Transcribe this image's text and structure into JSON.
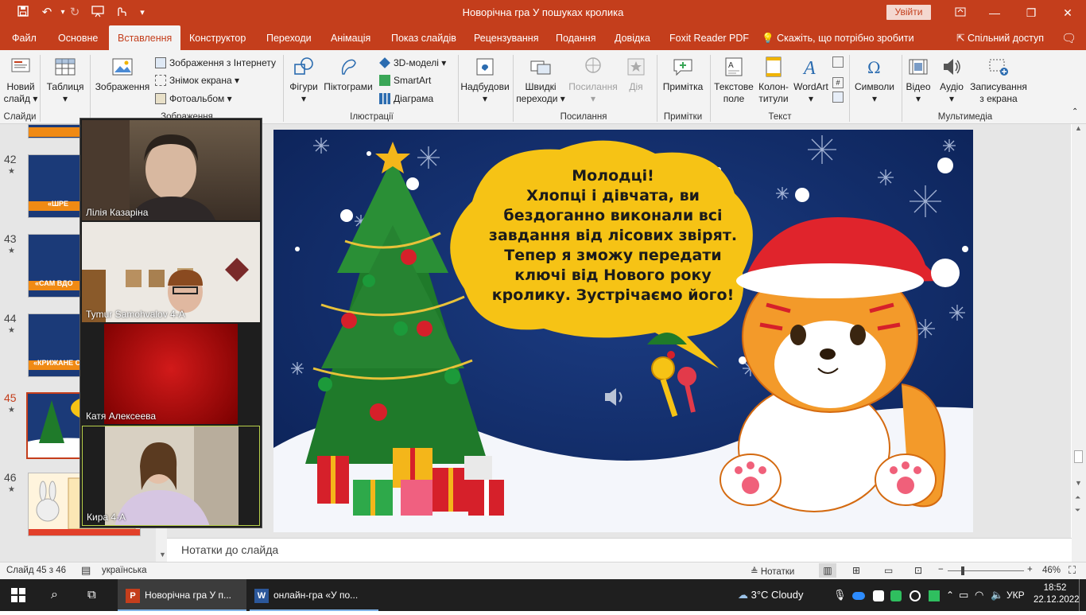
{
  "window": {
    "title": "Новорічна гра У пошуках кролика",
    "signin_label": "Увійти"
  },
  "tabs": [
    {
      "label": "Файл"
    },
    {
      "label": "Основне"
    },
    {
      "label": "Вставлення"
    },
    {
      "label": "Конструктор"
    },
    {
      "label": "Переходи"
    },
    {
      "label": "Анімація"
    },
    {
      "label": "Показ слайдів"
    },
    {
      "label": "Рецензування"
    },
    {
      "label": "Подання"
    },
    {
      "label": "Довідка"
    },
    {
      "label": "Foxit Reader PDF"
    }
  ],
  "tellme": "Скажіть, що потрібно зробити",
  "share": "Спільний доступ",
  "ribbon": {
    "new_slide": [
      "Новий",
      "слайд"
    ],
    "table": "Таблиця",
    "images": "Зображення",
    "online_images": "Зображення з Інтернету",
    "screenshot": "Знімок екрана",
    "photo_album": "Фотоальбом",
    "shapes": "Фігури",
    "icons": "Піктограми",
    "models3d": "3D-моделі",
    "smartart": "SmartArt",
    "chart": "Діаграма",
    "addins": "Надбудови",
    "zoom": [
      "Швидкі",
      "переходи"
    ],
    "link": "Посилання",
    "action": "Дія",
    "comment": "Примітка",
    "textbox": [
      "Текстове",
      "поле"
    ],
    "header": [
      "Колон-",
      "титули"
    ],
    "wordart": "WordArt",
    "symbols": "Символи",
    "video": "Відео",
    "audio": "Аудіо",
    "screenrec": [
      "Записування",
      "з екрана"
    ],
    "groups": {
      "slides": "Слайди",
      "images": "Зображення",
      "illustrations": "Ілюстрації",
      "links": "Посилання",
      "comments": "Примітки",
      "text": "Текст",
      "media": "Мультимедіа"
    }
  },
  "thumbnails": [
    {
      "num": "42",
      "caption": "«ШРЕ"
    },
    {
      "num": "43",
      "caption": "«САМ ВДО"
    },
    {
      "num": "44",
      "caption": "«КРИЖАНЕ С"
    },
    {
      "num": "45",
      "caption": ""
    },
    {
      "num": "46",
      "caption": ""
    }
  ],
  "slide": {
    "bubble_text": "Молодці!\nХлопці і дівчата, ви бездоганно виконали всі завдання від лісових звірят. Тепер я зможу передати ключі від Нового року кролику. Зустрічаємо його!"
  },
  "notes_placeholder": "Нотатки до слайда",
  "status": {
    "slide_counter": "Слайд 45 з 46",
    "language": "українська",
    "notes_label": "Нотатки",
    "zoom": "46%",
    "zoom_level": 0.46
  },
  "participants": [
    {
      "name": "Лілія Казаріна"
    },
    {
      "name": "Tymur Samohvalov 4-А"
    },
    {
      "name": "Катя Алексеева"
    },
    {
      "name": "Кира 4-А"
    }
  ],
  "taskbar": {
    "app1": "Новорічна гра У п...",
    "app2": "онлайн-гра «У по...",
    "weather": "3°C  Cloudy",
    "lang": "УКР",
    "time": "18:52",
    "date": "22.12.2022"
  },
  "colors": {
    "accent": "#c43e1c",
    "slide_bg": "#0f2a63",
    "bubble": "#f6c315"
  }
}
